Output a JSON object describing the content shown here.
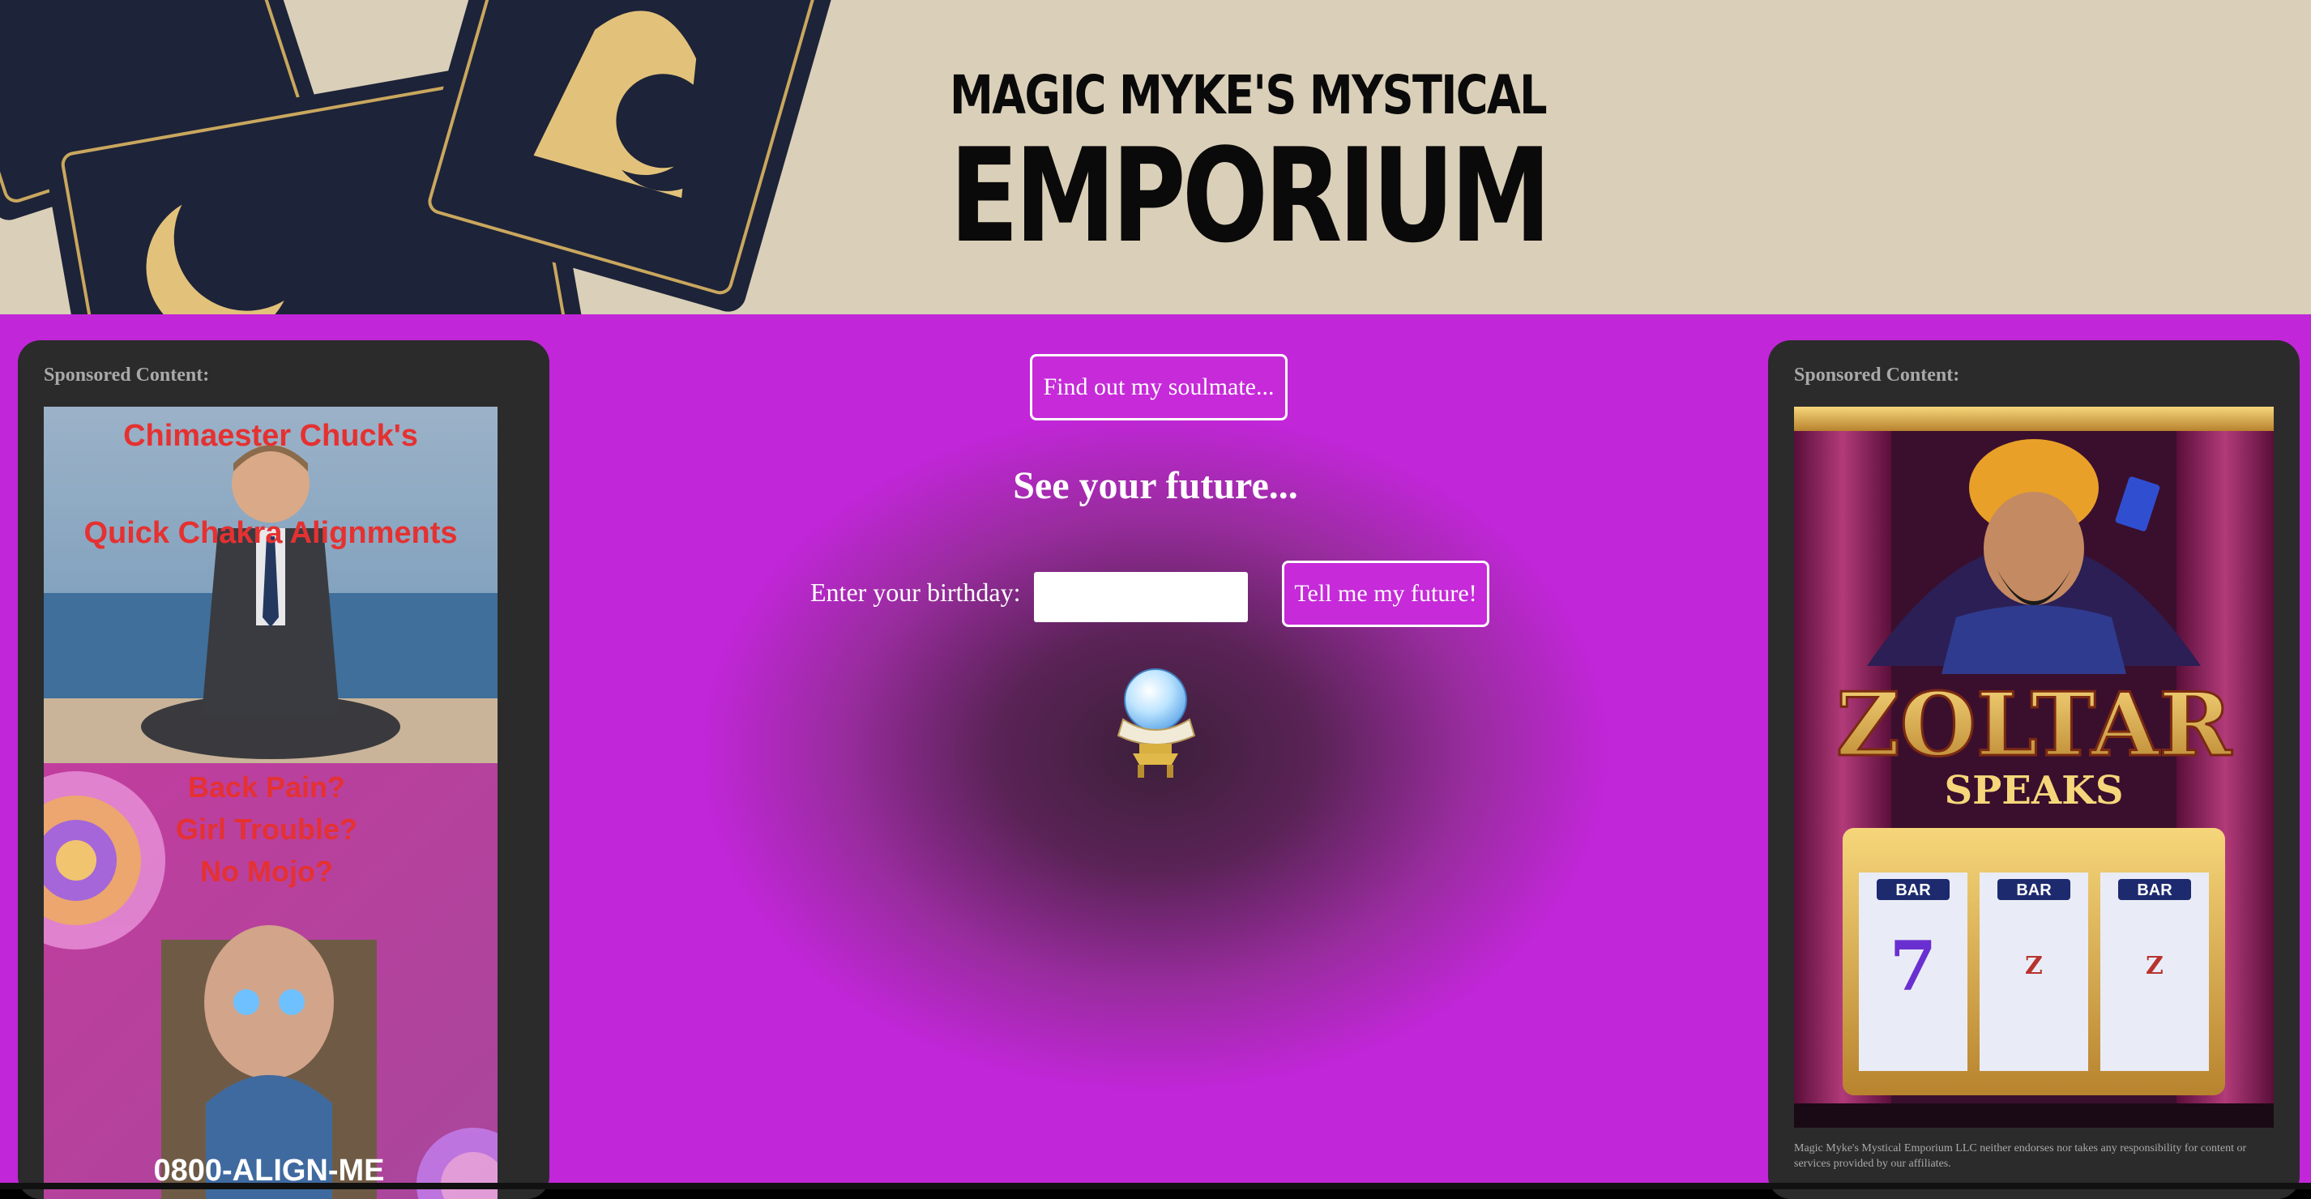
{
  "header": {
    "logo_top": "MAGIC MYKE'S MYSTICAL",
    "logo_main": "EMPORIUM"
  },
  "left_ad": {
    "label": "Sponsored Content:",
    "title_line1": "Chimaester Chuck's",
    "title_line2": "Quick Chakra Alignments",
    "q1": "Back Pain?",
    "q2": "Girl Trouble?",
    "q3": "No Mojo?",
    "phone": "0800-ALIGN-ME"
  },
  "right_ad": {
    "label": "Sponsored Content:",
    "title": "ZOLTAR",
    "subtitle": "SPEAKS",
    "reel1": "BAR",
    "reel2": "BAR",
    "reel3": "BAR",
    "disclaimer": "Magic Myke's Mystical Emporium LLC neither endorses nor takes any responsibility for content or services provided by our affiliates."
  },
  "main": {
    "soulmate_button": "Find out my soulmate...",
    "heading": "See your future...",
    "birthday_label": "Enter your birthday:",
    "birthday_value": "",
    "future_button": "Tell me my future!"
  },
  "colors": {
    "accent": "#c62ad9",
    "panel": "#2b2b2b",
    "header_bg": "#dacfb8"
  },
  "icons": {
    "crystal_ball": "crystal-ball-icon"
  }
}
